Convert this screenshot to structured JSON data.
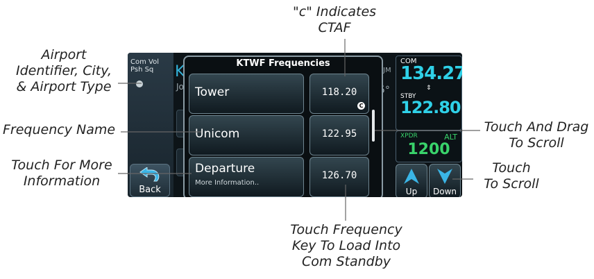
{
  "callouts": {
    "c_indicates": [
      "\"c\" Indicates",
      "CTAF"
    ],
    "airport_id": [
      "Airport",
      "Identifier, City,",
      "& Airport Type"
    ],
    "freq_name": [
      "Frequency Name"
    ],
    "touch_more": [
      "Touch For More",
      "Information"
    ],
    "touch_drag": [
      "Touch And Drag",
      "To Scroll"
    ],
    "touch_scroll": [
      "Touch",
      "To Scroll"
    ],
    "touch_freq": [
      "Touch Frequency",
      "Key To Load Into",
      "Com Standby"
    ]
  },
  "left_panel": {
    "com_vol": "Com Vol",
    "psh_sq": "Psh Sq",
    "back_label": "Back"
  },
  "background": {
    "airport_letter": "K",
    "city_abbrev": "Jo",
    "unit_text": "JM",
    "degree_text": "5°"
  },
  "popup": {
    "title": "KTWF Frequencies",
    "rows": [
      {
        "name": "Tower",
        "sub": "",
        "freq": "118.20",
        "ctaf": "C"
      },
      {
        "name": "Unicom",
        "sub": "",
        "freq": "122.95",
        "ctaf": ""
      },
      {
        "name": "Departure",
        "sub": "More Information..",
        "freq": "126.70",
        "ctaf": ""
      }
    ]
  },
  "com_panel": {
    "com_label": "COM",
    "active": "134.27",
    "swap": "⇕",
    "stby_label": "STBY",
    "standby": "122.80",
    "xpdr_label": "XPDR",
    "alt_label": "ALT",
    "squawk": "1200",
    "up_label": "Up",
    "down_label": "Down"
  },
  "colors": {
    "accent_cyan": "#2fd1e8",
    "xpdr_green": "#39d36b",
    "arrow_blue": "#3ab5e6"
  }
}
